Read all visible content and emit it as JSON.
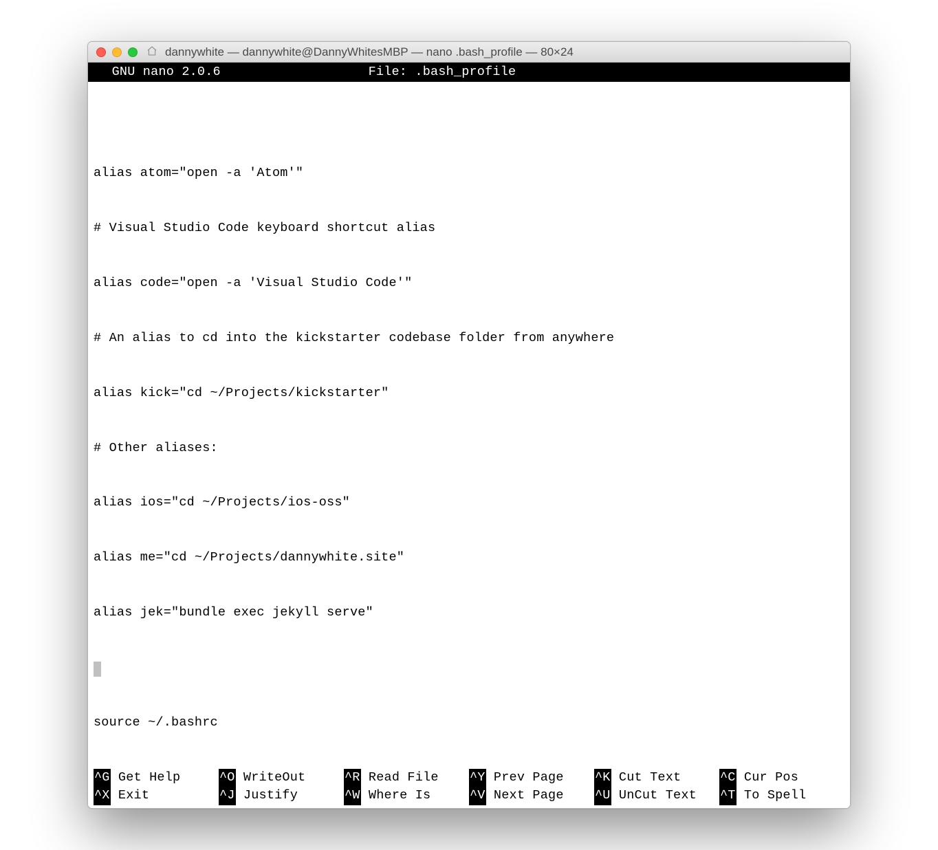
{
  "window": {
    "title": "dannywhite — dannywhite@DannyWhitesMBP — nano .bash_profile — 80×24"
  },
  "nano": {
    "app": "  GNU nano 2.0.6",
    "file_label": "File: .bash_profile"
  },
  "content": {
    "lines": [
      "alias atom=\"open -a 'Atom'\"",
      "# Visual Studio Code keyboard shortcut alias",
      "alias code=\"open -a 'Visual Studio Code'\"",
      "# An alias to cd into the kickstarter codebase folder from anywhere",
      "alias kick=\"cd ~/Projects/kickstarter\"",
      "# Other aliases:",
      "alias ios=\"cd ~/Projects/ios-oss\"",
      "alias me=\"cd ~/Projects/dannywhite.site\"",
      "alias jek=\"bundle exec jekyll serve\"",
      "",
      "source ~/.bashrc"
    ]
  },
  "shortcuts": {
    "row1": [
      {
        "key": "^G",
        "label": " Get Help"
      },
      {
        "key": "^O",
        "label": " WriteOut"
      },
      {
        "key": "^R",
        "label": " Read File"
      },
      {
        "key": "^Y",
        "label": " Prev Page"
      },
      {
        "key": "^K",
        "label": " Cut Text"
      },
      {
        "key": "^C",
        "label": " Cur Pos"
      }
    ],
    "row2": [
      {
        "key": "^X",
        "label": " Exit"
      },
      {
        "key": "^J",
        "label": " Justify"
      },
      {
        "key": "^W",
        "label": " Where Is"
      },
      {
        "key": "^V",
        "label": " Next Page"
      },
      {
        "key": "^U",
        "label": " UnCut Text"
      },
      {
        "key": "^T",
        "label": " To Spell"
      }
    ]
  }
}
